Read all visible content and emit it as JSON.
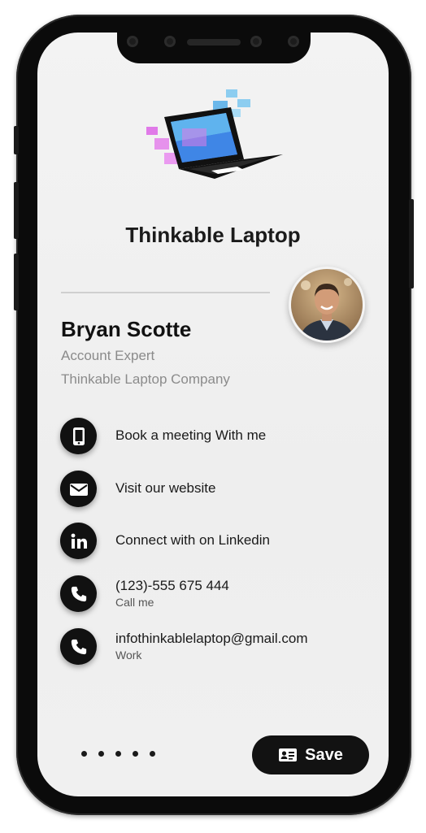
{
  "brand": {
    "title": "Thinkable Laptop",
    "logo_icon": "laptop-logo-icon",
    "colors": {
      "blue": "#3f86e6",
      "light_blue": "#8ccdf0",
      "pink": "#e07ae8"
    }
  },
  "profile": {
    "name": "Bryan Scotte",
    "role": "Account Expert",
    "company": "Thinkable Laptop Company",
    "avatar_icon": "profile-photo"
  },
  "contacts": [
    {
      "icon": "mobile-phone-icon",
      "label": "Book a meeting With me",
      "sub": ""
    },
    {
      "icon": "envelope-icon",
      "label": "Visit our website",
      "sub": ""
    },
    {
      "icon": "linkedin-icon",
      "label": "Connect with on Linkedin",
      "sub": ""
    },
    {
      "icon": "phone-icon",
      "label": "(123)-555 675 444",
      "sub": "Call me"
    },
    {
      "icon": "phone-icon",
      "label": "infothinkablelaptop@gmail.com",
      "sub": "Work"
    }
  ],
  "footer": {
    "page_dots": 5,
    "save_label": "Save",
    "save_icon": "contact-card-icon"
  },
  "theme": {
    "accent": "#111111",
    "background": "#f0f0f0",
    "muted_text": "#8b8b8b"
  }
}
